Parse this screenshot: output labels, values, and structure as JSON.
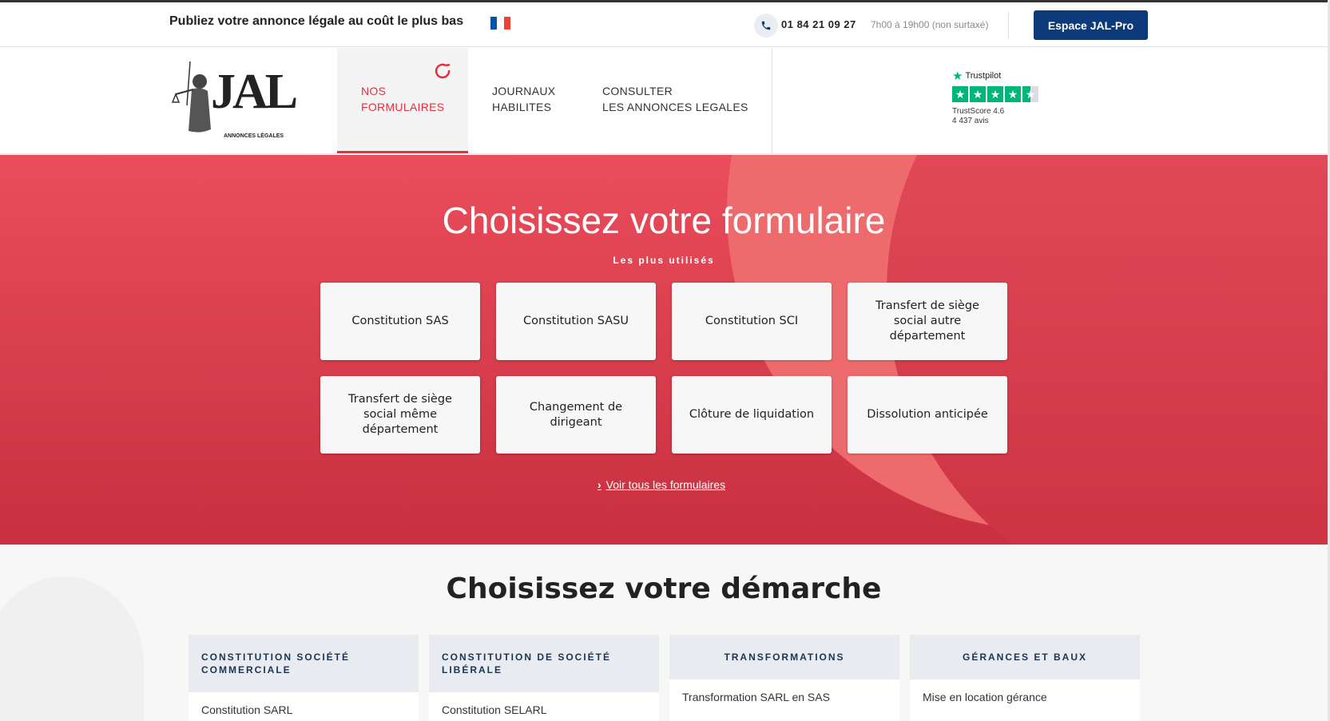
{
  "topbar": {
    "tagline": "Publiez votre annonce légale au coût le plus bas",
    "flag_colors": [
      "#0055a4",
      "#ffffff",
      "#ef4135"
    ],
    "phone": "01 84 21 09 27",
    "hours": "7h00 à 19h00 (non surtaxé)",
    "pro_button": "Espace JAL-Pro",
    "pro_color": "#0d3a7a"
  },
  "logo": {
    "mark": "JAL",
    "subtitle": "ANNONCES LÉGALES"
  },
  "nav": {
    "items": [
      {
        "label": "NOS FORMULAIRES",
        "active": true
      },
      {
        "label": "JOURNAUX HABILITES",
        "active": false
      },
      {
        "label": "CONSULTER LES ANNONCES LEGALES",
        "active": false
      }
    ],
    "accent_color": "#e0323e"
  },
  "trustpilot": {
    "brand": "Trustpilot",
    "score": "TrustScore 4.6",
    "reviews": "4 437 avis",
    "color": "#00b67a"
  },
  "hero": {
    "title": "Choisissez votre formulaire",
    "subtitle": "Les plus utilisés",
    "cards": [
      "Constitution SAS",
      "Constitution SASU",
      "Constitution SCI",
      "Transfert de siège social autre département",
      "Transfert de siège social même département",
      "Changement de dirigeant",
      "Clôture de liquidation",
      "Dissolution anticipée"
    ],
    "see_all": "Voir tous les formulaires"
  },
  "demarche": {
    "title": "Choisissez votre démarche",
    "columns": [
      {
        "heading": "CONSTITUTION SOCIÉTÉ COMMERCIALE",
        "first_item": "Constitution SARL"
      },
      {
        "heading": "CONSTITUTION DE SOCIÉTÉ LIBÉRALE",
        "first_item": "Constitution SELARL"
      },
      {
        "heading": "TRANSFORMATIONS",
        "first_item": "Transformation SARL en SAS"
      },
      {
        "heading": "GÉRANCES ET BAUX",
        "first_item": "Mise en location gérance"
      }
    ]
  }
}
